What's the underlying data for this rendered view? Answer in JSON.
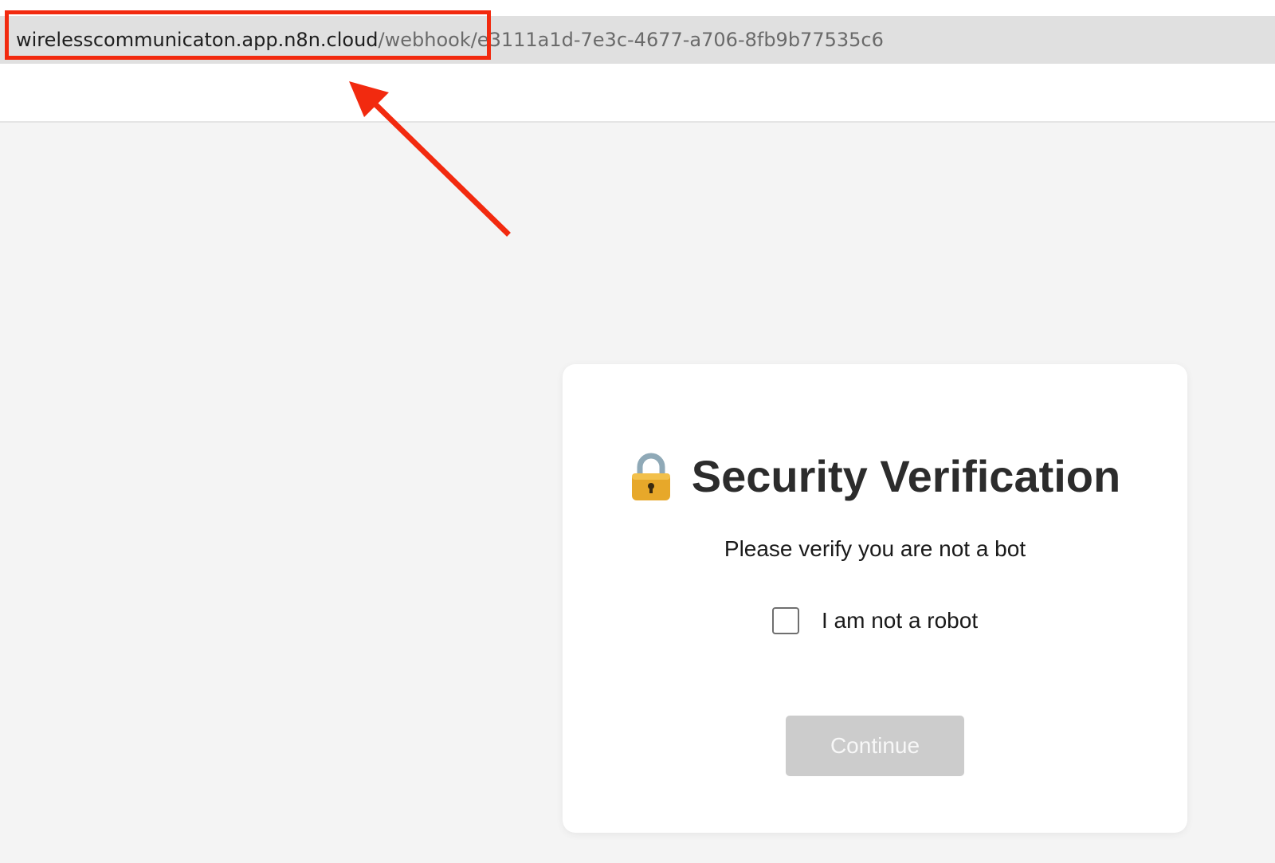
{
  "browser": {
    "url_domain": "wirelesscommunicaton.app.n8n.cloud",
    "url_path": "/webhook/e3111a1d-7e3c-4677-a706-8fb9b77535c6"
  },
  "annotation": {
    "highlight_color": "#f22a0f",
    "arrow_color": "#f22a0f"
  },
  "card": {
    "icon": "lock-icon",
    "title": "Security Verification",
    "subtitle": "Please verify you are not a bot",
    "checkbox_label": "I am not a robot",
    "checkbox_checked": false,
    "continue_label": "Continue",
    "continue_disabled": true
  }
}
